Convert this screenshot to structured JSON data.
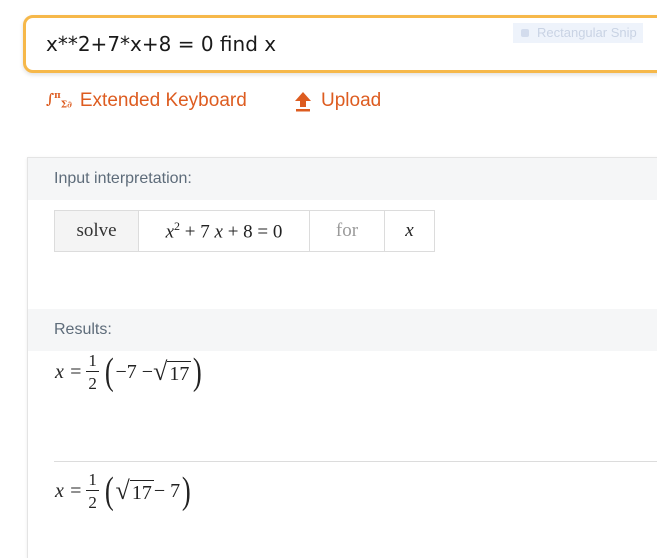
{
  "search": {
    "query": "x**2+7*x+8 = 0 find x",
    "overlay_label": "Rectangular Snip"
  },
  "actions": {
    "keyboard_label": "Extended Keyboard",
    "keyboard_icon": "math-symbols-icon",
    "upload_label": "Upload",
    "upload_icon": "upload-arrow-icon"
  },
  "input_interpretation": {
    "header": "Input interpretation:",
    "verb": "solve",
    "equation": {
      "var": "x",
      "exp": "2",
      "rest": "+ 7",
      "var2": "x",
      "tail": "+ 8 = 0"
    },
    "for_label": "for",
    "variable": "x"
  },
  "results": {
    "header": "Results:",
    "items": [
      {
        "lhs": "x =",
        "num": "1",
        "den": "2",
        "a": "−7 − ",
        "radicand": "17",
        "b": ""
      },
      {
        "lhs": "x =",
        "num": "1",
        "den": "2",
        "a": "",
        "radicand": "17",
        "b": " − 7"
      }
    ]
  },
  "colors": {
    "accent": "#dd5c20",
    "search_border": "#f6b84a",
    "header_bg": "#f5f6f7",
    "header_text": "#5e6c7a"
  }
}
